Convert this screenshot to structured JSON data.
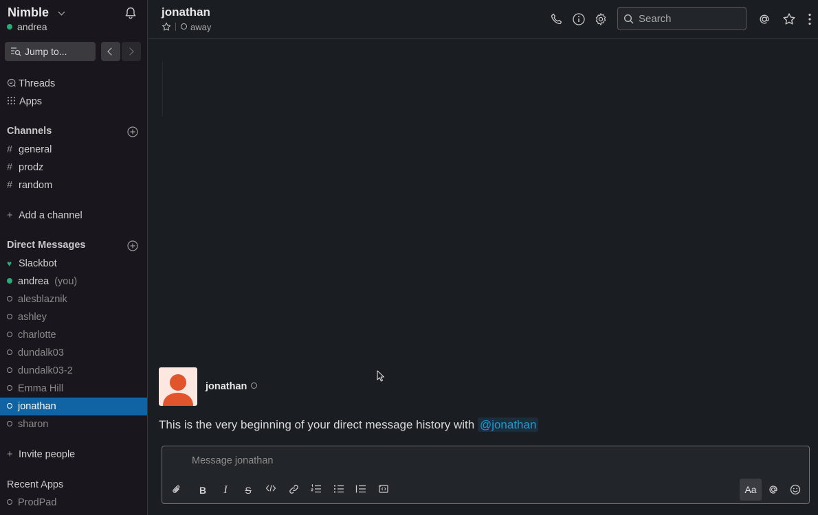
{
  "workspace": {
    "name": "Nimble",
    "user": "andrea"
  },
  "sidebar": {
    "jump_to_label": "Jump to...",
    "nav_items": [
      {
        "label": "Threads",
        "icon": "threads-icon"
      },
      {
        "label": "Apps",
        "icon": "apps-grid-icon"
      }
    ],
    "channels_title": "Channels",
    "channels": [
      "general",
      "prodz",
      "random"
    ],
    "add_channel_label": "Add a channel",
    "dm_title": "Direct Messages",
    "dms": [
      {
        "name": "Slackbot",
        "status": "bot"
      },
      {
        "name": "andrea",
        "suffix": "(you)",
        "status": "online"
      },
      {
        "name": "alesblaznik",
        "status": "away"
      },
      {
        "name": "ashley",
        "status": "away"
      },
      {
        "name": "charlotte",
        "status": "away"
      },
      {
        "name": "dundalk03",
        "status": "away"
      },
      {
        "name": "dundalk03-2",
        "status": "away"
      },
      {
        "name": "Emma Hill",
        "status": "away"
      },
      {
        "name": "jonathan",
        "status": "away",
        "active": true
      },
      {
        "name": "sharon",
        "status": "away"
      }
    ],
    "invite_label": "Invite people",
    "recent_apps_title": "Recent Apps",
    "recent_apps": [
      "ProdPad"
    ]
  },
  "header": {
    "title": "jonathan",
    "status": "away",
    "search_placeholder": "Search"
  },
  "conversation": {
    "author": "jonathan",
    "intro_text": "This is the very beginning of your direct message history with ",
    "mention": "@jonathan"
  },
  "composer": {
    "placeholder": "Message jonathan",
    "format_label": "Aa"
  },
  "colors": {
    "sidebar_bg": "#19171d",
    "main_bg": "#1a1d21",
    "active_item": "#1164a3",
    "online_green": "#2bac76",
    "mention_blue": "#1d9bd1",
    "avatar_orange": "#e0552b"
  }
}
